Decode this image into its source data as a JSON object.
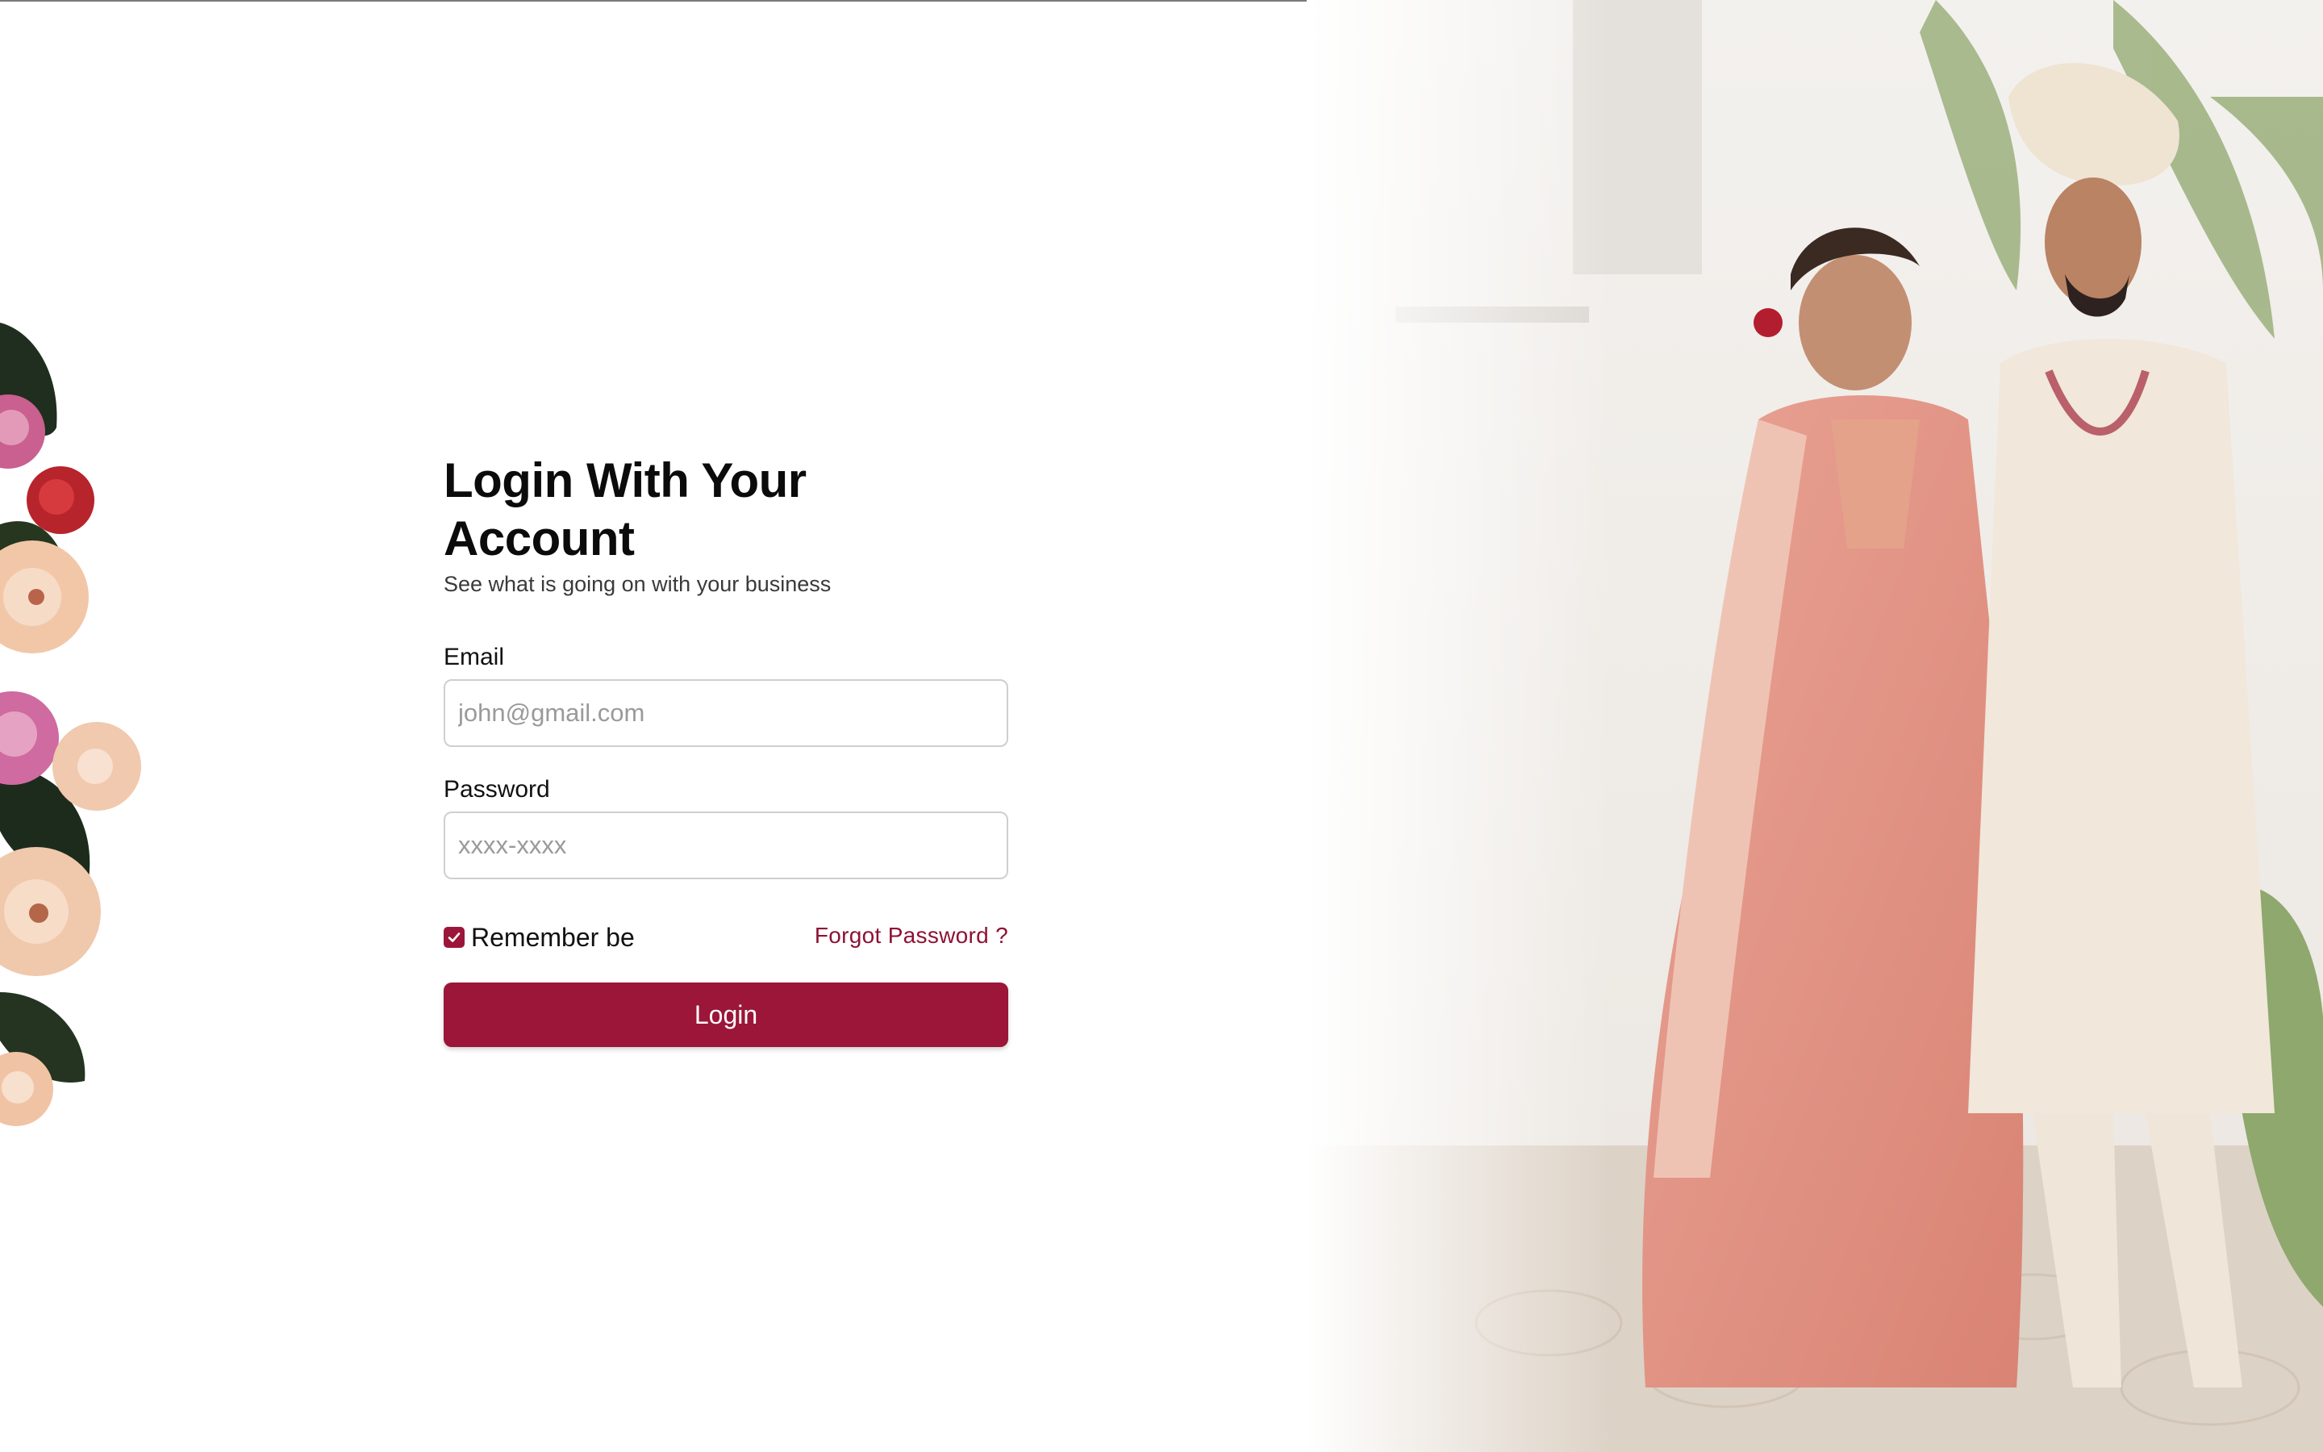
{
  "login": {
    "title": "Login With Your Account",
    "subtitle": "See what is going on with your business",
    "email_label": "Email",
    "email_placeholder": "john@gmail.com",
    "email_value": "",
    "password_label": "Password",
    "password_placeholder": "xxxx-xxxx",
    "password_value": "",
    "remember_label": "Remember be",
    "remember_checked": true,
    "forgot_label": "Forgot Password ?",
    "login_button_label": "Login"
  },
  "decor": {
    "left_image": "floral-bouquet",
    "right_image": "wedding-couple-photo"
  },
  "colors": {
    "accent": "#9b1638",
    "link": "#8e1233",
    "input_border": "#cfcfcf",
    "placeholder": "#9a9a9a"
  }
}
